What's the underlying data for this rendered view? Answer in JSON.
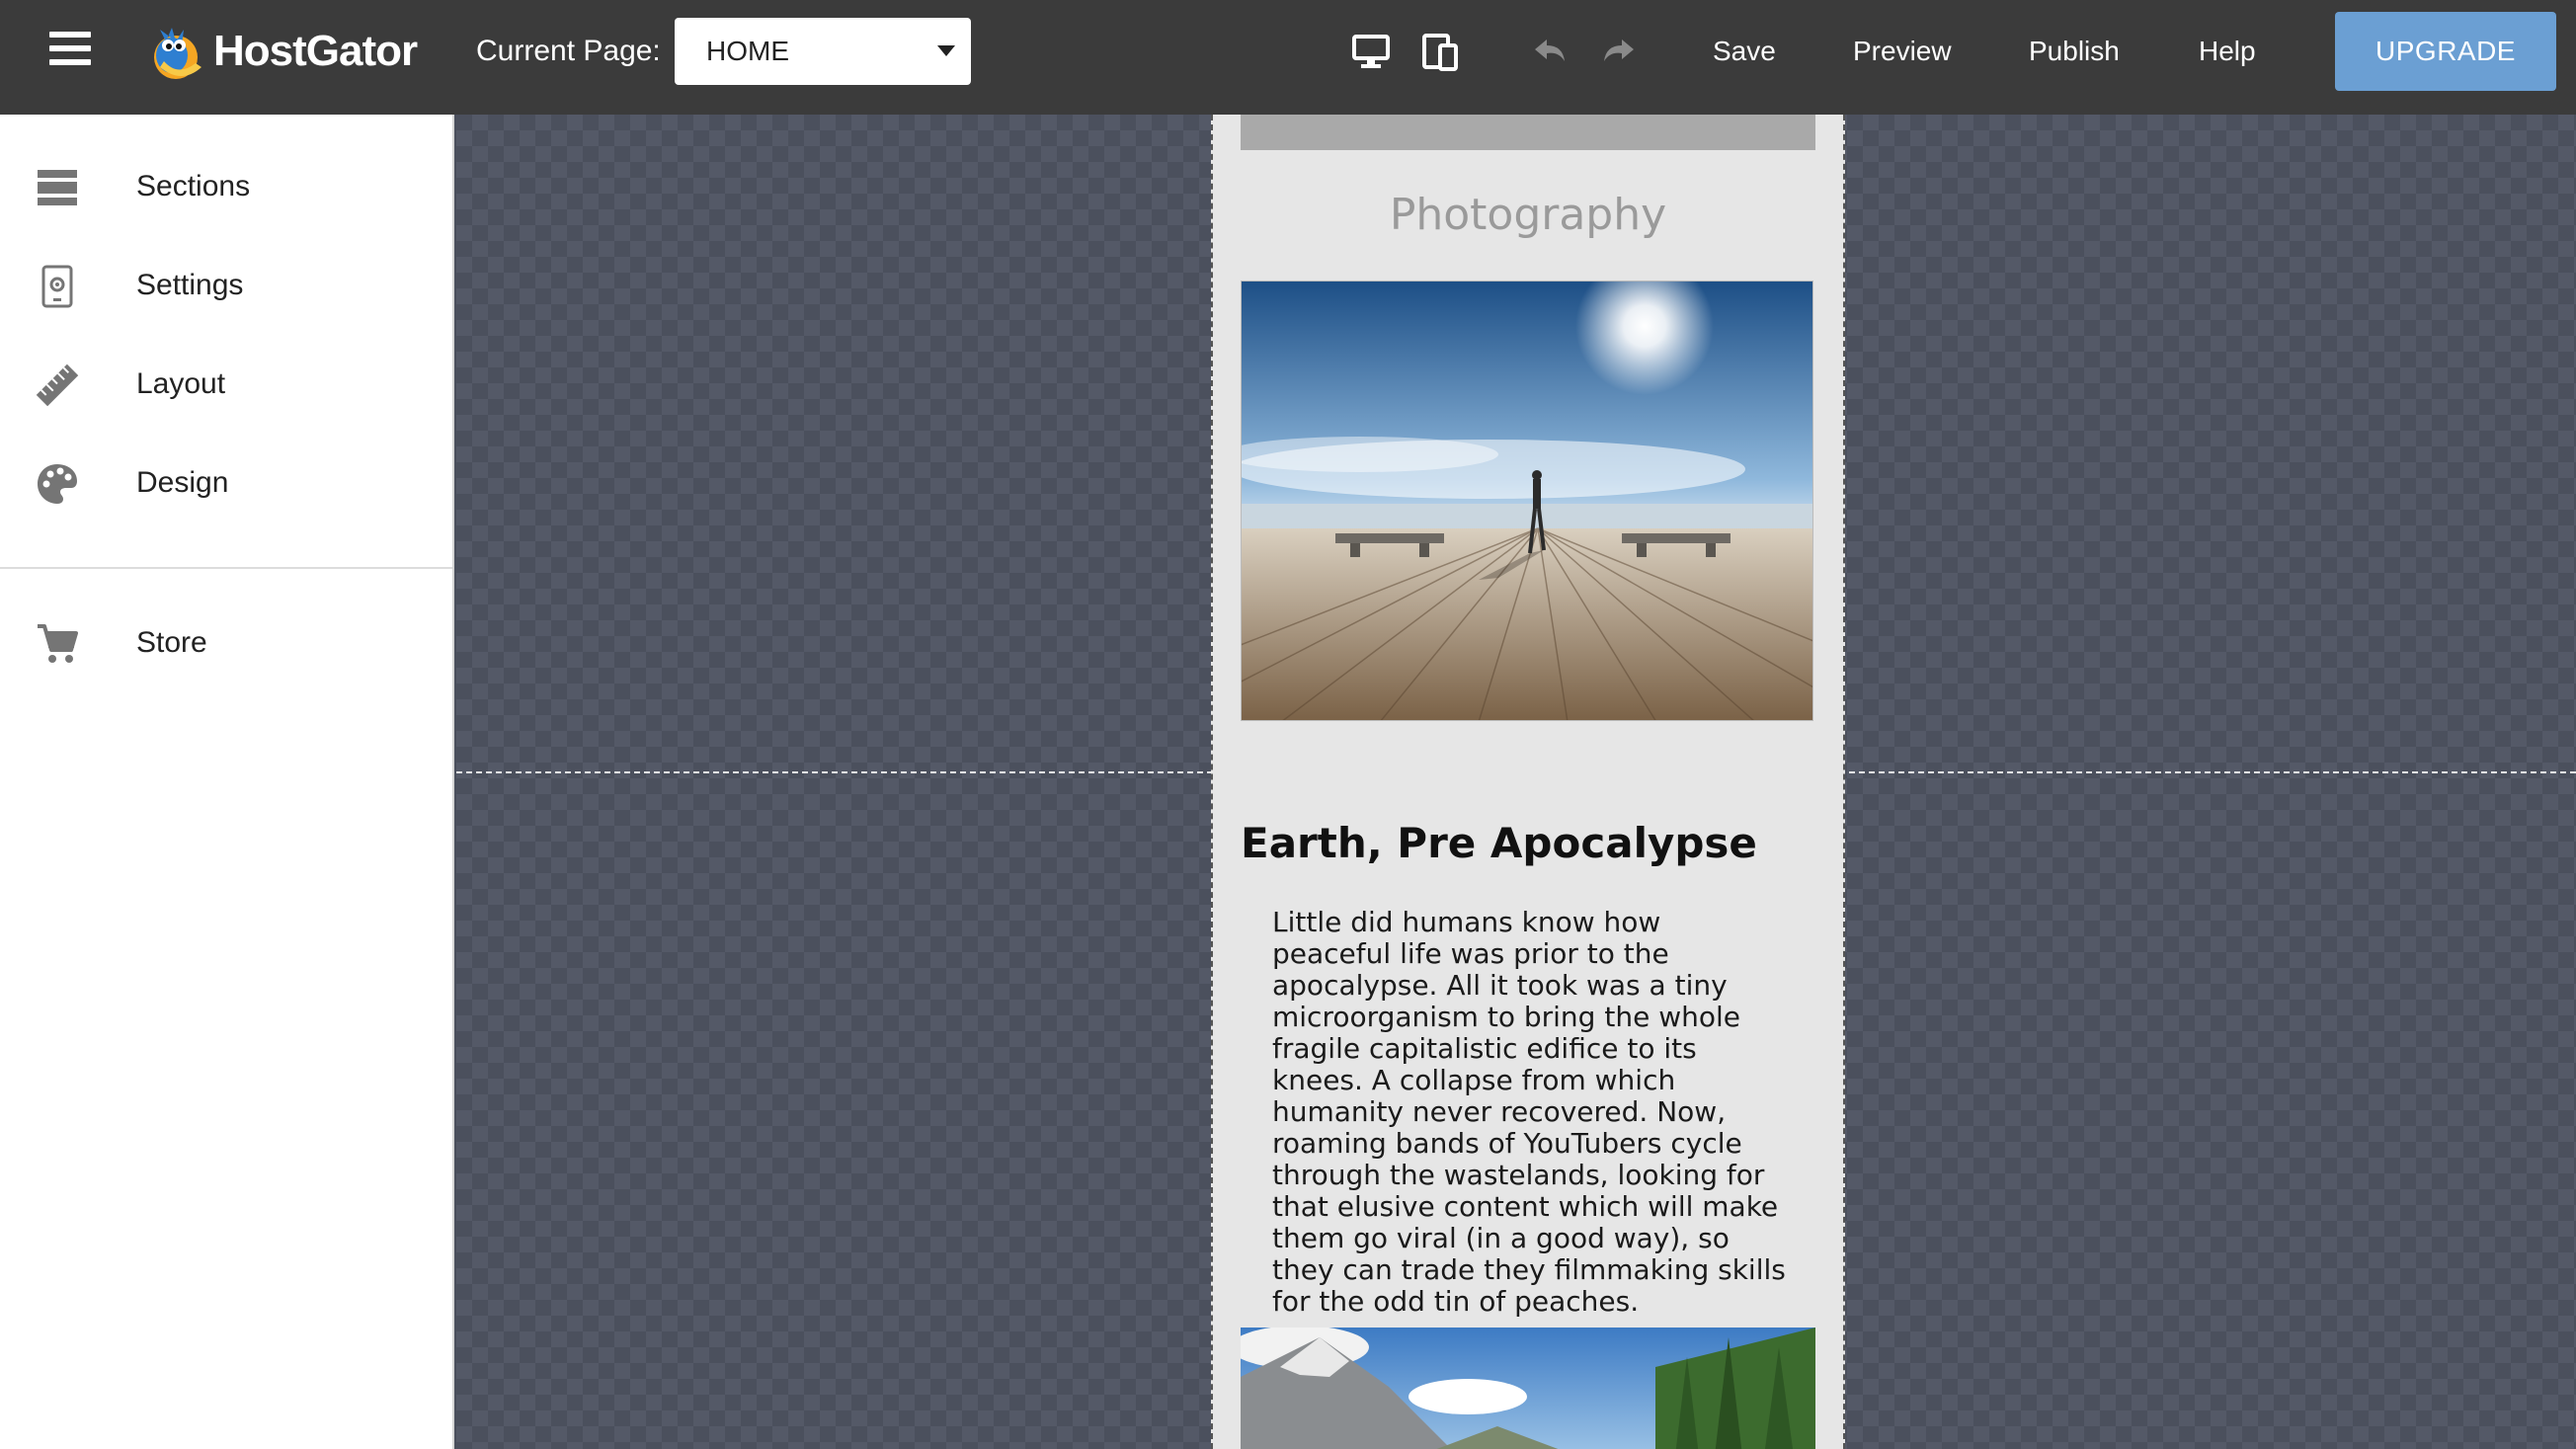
{
  "topbar": {
    "logo_text": "HostGator",
    "current_page_label": "Current Page:",
    "current_page_value": "HOME",
    "desktop_view_icon": "desktop-icon",
    "mobile_view_icon": "tablet-mobile-icon",
    "undo_icon": "undo-icon",
    "redo_icon": "redo-icon",
    "save_label": "Save",
    "preview_label": "Preview",
    "publish_label": "Publish",
    "help_label": "Help",
    "upgrade_label": "UPGRADE",
    "upgrade_color": "#6b9fd3"
  },
  "sidebar": {
    "items": [
      {
        "label": "Sections",
        "icon": "sections-icon"
      },
      {
        "label": "Settings",
        "icon": "settings-icon"
      },
      {
        "label": "Layout",
        "icon": "ruler-icon"
      },
      {
        "label": "Design",
        "icon": "palette-icon"
      },
      {
        "label": "Store",
        "icon": "cart-icon"
      }
    ]
  },
  "content": {
    "photo_section_title": "Photography",
    "article_title": "Earth, Pre Apocalypse",
    "article_body": "Little did humans know how peaceful life was prior to the apocalypse. All it took was a tiny microorganism to bring the whole fragile capitalistic edifice to its knees. A collapse from which humanity never recovered. Now, roaming bands of YouTubers cycle through the wastelands, looking for that elusive content which will make them go viral (in a good way), so they can trade they filmmaking skills for the odd tin of peaches."
  }
}
